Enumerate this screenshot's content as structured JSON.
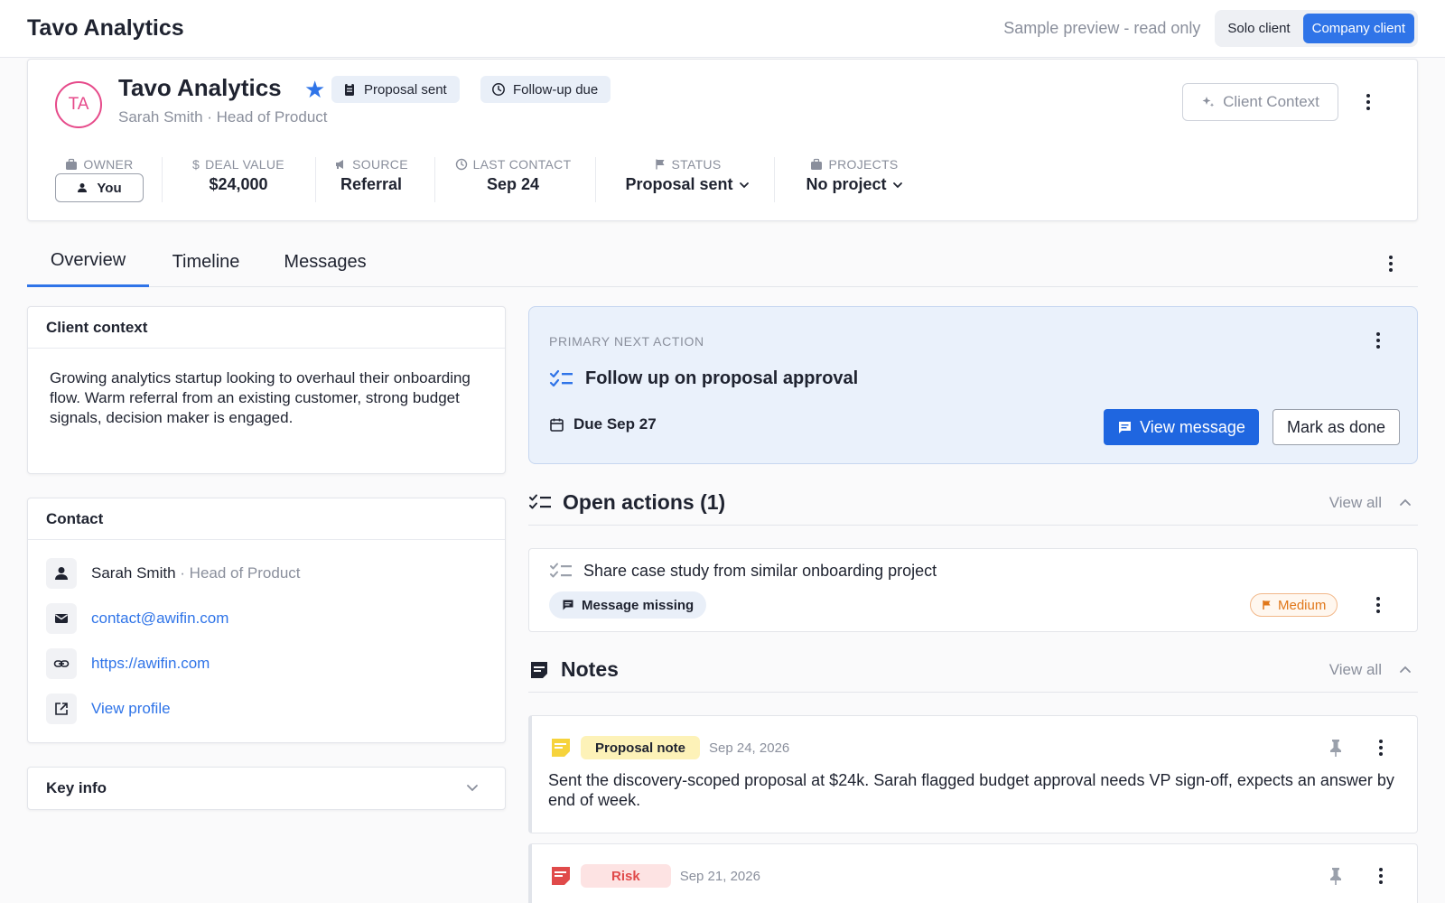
{
  "topbar": {
    "app_title": "Tavo Analytics",
    "preview_note": "Sample preview - read only",
    "mode_options": [
      "Solo client",
      "Company client"
    ],
    "active_mode": "Company client"
  },
  "client": {
    "initials": "TA",
    "name": "Tavo Analytics",
    "subtitle": "Sarah Smith · Head of Product",
    "chips": [
      "Proposal sent",
      "Follow-up due"
    ],
    "context_button": "Client Context",
    "meta": {
      "owner_label": "OWNER",
      "owner_value": "You",
      "deal_label": "DEAL VALUE",
      "deal_value": "$24,000",
      "source_label": "SOURCE",
      "source_value": "Referral",
      "last_contact_label": "LAST CONTACT",
      "last_contact_value": "Sep 24",
      "status_label": "STATUS",
      "status_value": "Proposal sent",
      "projects_label": "PROJECTS",
      "projects_value": "No project"
    }
  },
  "tabs": [
    "Overview",
    "Timeline",
    "Messages"
  ],
  "active_tab": "Overview",
  "client_context": {
    "title": "Client context",
    "body": "Growing analytics startup looking to overhaul their onboarding flow. Warm referral from an existing customer, strong budget signals, decision maker is engaged."
  },
  "contact": {
    "title": "Contact",
    "name": "Sarah Smith",
    "role": "· Head of Product",
    "email": "contact@awifin.com",
    "website": "https://awifin.com",
    "profile_link": "View profile"
  },
  "key_info": {
    "title": "Key info"
  },
  "primary_action": {
    "label": "PRIMARY NEXT ACTION",
    "title": "Follow up on proposal approval",
    "due": "Due Sep 27",
    "view_message": "View message",
    "mark_done": "Mark as done"
  },
  "open_actions": {
    "title": "Open actions (1)",
    "view_all": "View all",
    "items": [
      {
        "title": "Share case study from similar onboarding project",
        "tag": "Message missing",
        "priority": "Medium"
      }
    ]
  },
  "notes": {
    "title": "Notes",
    "view_all": "View all",
    "items": [
      {
        "tag": "Proposal note",
        "date": "Sep 24, 2026",
        "body": "Sent the discovery-scoped proposal at $24k. Sarah flagged budget approval needs VP sign-off, expects an answer by end of week."
      },
      {
        "tag": "Risk",
        "date": "Sep 21, 2026",
        "body": ""
      }
    ]
  },
  "colors": {
    "accent": "#2f74e8",
    "avatar": "#e64a8a",
    "medium_priority": "#e0771a",
    "risk": "#e04a4a",
    "note_yellow": "#f6d33c"
  }
}
